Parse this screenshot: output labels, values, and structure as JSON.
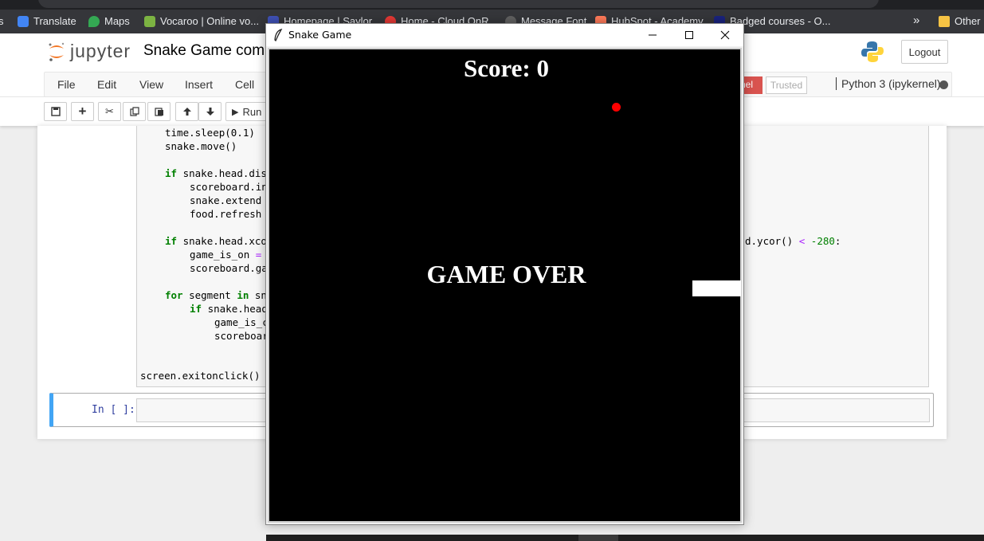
{
  "bookmarks": [
    {
      "label": "Translate",
      "color": "#4285f4"
    },
    {
      "label": "Maps",
      "color": "#34a853"
    },
    {
      "label": "Vocaroo | Online vo...",
      "color": "#7cb342"
    },
    {
      "label": "Homepage | Saylor...",
      "color": "#3f51b5"
    },
    {
      "label": "Home - Cloud OnR...",
      "color": "#e53935"
    },
    {
      "label": "Message Font",
      "color": "#616161"
    },
    {
      "label": "HubSpot - Academy",
      "color": "#ff7a59"
    },
    {
      "label": "Badged courses - O...",
      "color": "#1a237e"
    }
  ],
  "bookmarks_more": "»",
  "bookmarks_other": "Other",
  "jupyter": {
    "logo_text": "jupyter",
    "notebook_title": "Snake Game com",
    "logout_label": "Logout",
    "menu": [
      "File",
      "Edit",
      "View",
      "Insert",
      "Cell"
    ],
    "kernel_badge": "nel",
    "trusted_label": "Trusted",
    "kernel_name": "Python 3 (ipykernel)",
    "run_label": "Run",
    "prompt": "In [ ]:"
  },
  "code": {
    "l1": "time.sleep(0.1)",
    "l2": "snake.move()",
    "l3_kw": "if",
    "l3": " snake.head.dis",
    "l4": "scoreboard.in",
    "l5": "snake.extend",
    "l6": "food.refresh",
    "l7_kw": "if",
    "l7": " snake.head.xco",
    "l7_tail": "d.ycor() ",
    "l7_op": "<",
    "l7_num": " -280",
    "l7_end": ":",
    "l8": "game_is_on ",
    "l8_op": "=",
    "l9": "scoreboard.ga",
    "l10_kw": "for",
    "l10": " segment ",
    "l10_kw2": "in",
    "l10_end": " sn",
    "l11_kw": "if",
    "l11": " snake.head",
    "l12": "game_is_c",
    "l13": "scoreboar",
    "l14": "screen.exitonclick()"
  },
  "snake_window": {
    "title": "Snake Game",
    "score_text": "Score: 0",
    "game_over_text": "GAME OVER",
    "food_color": "#ff0000",
    "background_color": "#000000"
  }
}
